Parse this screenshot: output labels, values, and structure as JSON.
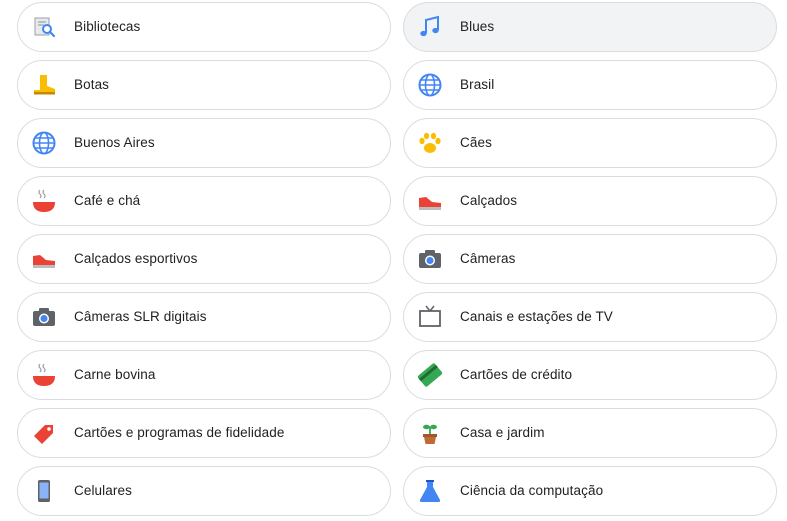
{
  "categories": [
    {
      "label": "Bibliotecas",
      "icon": "library-search-icon"
    },
    {
      "label": "Blues",
      "icon": "music-note-icon"
    },
    {
      "label": "Botas",
      "icon": "boot-icon"
    },
    {
      "label": "Brasil",
      "icon": "globe-icon"
    },
    {
      "label": "Buenos Aires",
      "icon": "globe-icon"
    },
    {
      "label": "Cães",
      "icon": "paw-icon"
    },
    {
      "label": "Café e chá",
      "icon": "bowl-icon"
    },
    {
      "label": "Calçados",
      "icon": "sneaker-icon"
    },
    {
      "label": "Calçados esportivos",
      "icon": "sneaker-icon"
    },
    {
      "label": "Câmeras",
      "icon": "camera-icon"
    },
    {
      "label": "Câmeras SLR digitais",
      "icon": "camera-icon"
    },
    {
      "label": "Canais e estações de TV",
      "icon": "tv-icon"
    },
    {
      "label": "Carne bovina",
      "icon": "bowl-icon"
    },
    {
      "label": "Cartões de crédito",
      "icon": "credit-card-icon"
    },
    {
      "label": "Cartões e programas de fidelidade",
      "icon": "tag-icon"
    },
    {
      "label": "Casa e jardim",
      "icon": "potted-plant-icon"
    },
    {
      "label": "Celulares",
      "icon": "smartphone-icon"
    },
    {
      "label": "Ciência da computação",
      "icon": "flask-icon"
    }
  ],
  "colors": {
    "chip_border": "#dadce0",
    "chip_hover_bg": "#f1f3f4",
    "text": "#202124",
    "blue": "#4285f4",
    "red": "#ea4335",
    "yellow": "#fbbc04",
    "green": "#34a853",
    "gray": "#5f6368"
  }
}
